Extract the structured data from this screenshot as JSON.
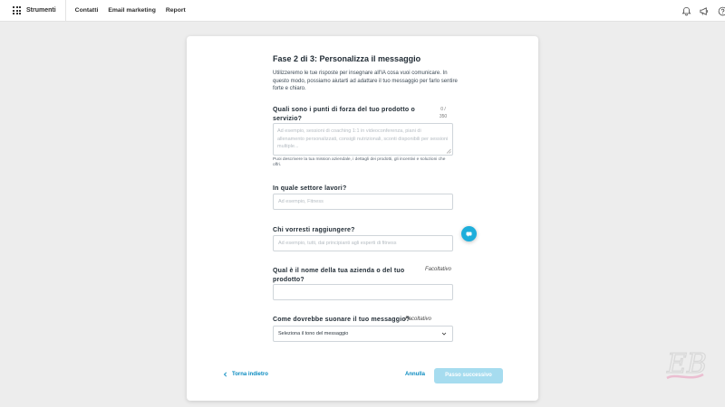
{
  "topbar": {
    "apps_label": "Strumenti",
    "nav": [
      "Contatti",
      "Email marketing",
      "Report"
    ],
    "icons": [
      "bell-icon",
      "megaphone-icon",
      "help-icon"
    ]
  },
  "form": {
    "title": "Fase 2 di 3: Personalizza il messaggio",
    "intro": "Utilizzeremo le tue risposte per insegnare all'IA cosa vuoi comunicare. In questo modo, possiamo aiutarti ad adattare il tuo messaggio per farlo sentire forte e chiaro.",
    "strengths": {
      "label": "Quali sono i punti di forza del tuo prodotto o servizio?",
      "counter": "0 / 350",
      "placeholder": "Ad esempio, sessioni di coaching 1:1 in videoconferenza, piani di allenamento personalizzati, consigli nutrizionali, sconti disponibili per sessioni multiple...",
      "hint": "Puoi descrivere la tua mission aziendale, i dettagli dei prodotti, gli incentivi e soluzioni che offri."
    },
    "sector": {
      "label": "In quale settore lavori?",
      "placeholder": "Ad esempio, Fitness"
    },
    "audience": {
      "label": "Chi vorresti raggiungere?",
      "placeholder": "Ad esempio, tutti, dai principianti agli esperti di fitness"
    },
    "company": {
      "label": "Qual è il nome della tua azienda o del tuo prodotto?",
      "optional": "Facoltativo",
      "value": ""
    },
    "tone": {
      "label": "Come dovrebbe suonare il tuo messaggio?",
      "optional": "Facoltativo",
      "selected": "Seleziona il tono del messaggio"
    }
  },
  "footer": {
    "back_label": "Torna indietro",
    "cancel_label": "Annulla",
    "next_label": "Passo successivo"
  },
  "colors": {
    "accent": "#0a8bc0",
    "next_disabled": "#a6dcef",
    "float_button": "#1eaedb"
  }
}
